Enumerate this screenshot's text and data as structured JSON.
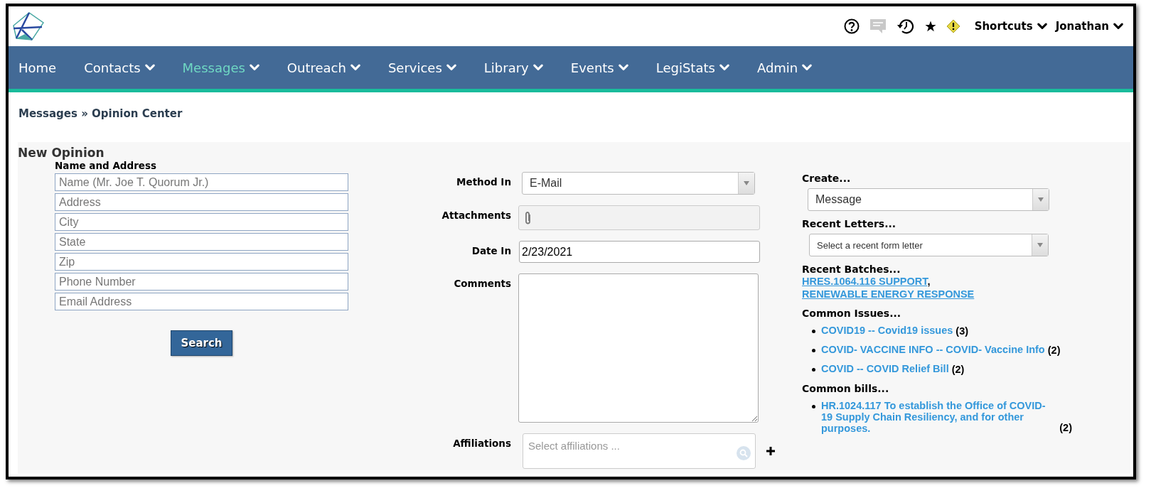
{
  "header": {
    "shortcuts": "Shortcuts",
    "user": "Jonathan"
  },
  "nav": [
    {
      "label": "Home",
      "has_menu": false,
      "selected": false
    },
    {
      "label": "Contacts",
      "has_menu": true,
      "selected": false
    },
    {
      "label": "Messages",
      "has_menu": true,
      "selected": true
    },
    {
      "label": "Outreach",
      "has_menu": true,
      "selected": false
    },
    {
      "label": "Services",
      "has_menu": true,
      "selected": false
    },
    {
      "label": "Library",
      "has_menu": true,
      "selected": false
    },
    {
      "label": "Events",
      "has_menu": true,
      "selected": false
    },
    {
      "label": "LegiStats",
      "has_menu": true,
      "selected": false
    },
    {
      "label": "Admin",
      "has_menu": true,
      "selected": false
    }
  ],
  "breadcrumb": "Messages » Opinion Center",
  "form": {
    "title": "New Opinion",
    "name_address": {
      "label": "Name and Address",
      "fields": [
        {
          "placeholder": "Name (Mr. Joe T. Quorum Jr.)"
        },
        {
          "placeholder": "Address"
        },
        {
          "placeholder": "City"
        },
        {
          "placeholder": "State"
        },
        {
          "placeholder": "Zip"
        },
        {
          "placeholder": "Phone Number"
        },
        {
          "placeholder": "Email Address"
        }
      ]
    },
    "search_button": "Search"
  },
  "details": {
    "method_in": {
      "label": "Method In",
      "value": "E-Mail"
    },
    "attachments": {
      "label": "Attachments"
    },
    "date_in": {
      "label": "Date In",
      "value": "2/23/2021"
    },
    "comments": {
      "label": "Comments"
    },
    "affiliations": {
      "label": "Affiliations",
      "placeholder": "Select affiliations ..."
    }
  },
  "sidebar": {
    "create": {
      "label": "Create...",
      "value": "Message"
    },
    "recent_letters": {
      "label": "Recent Letters...",
      "placeholder": "Select a recent form letter"
    },
    "recent_batches": {
      "label": "Recent Batches...",
      "separator": ",",
      "links": [
        "HRES.1064.116 SUPPORT",
        "RENEWABLE ENERGY RESPONSE"
      ]
    },
    "common_issues": {
      "label": "Common Issues...",
      "items": [
        {
          "link": "COVID19 -- Covid19 issues",
          "count": "(3)"
        },
        {
          "link": "COVID- VACCINE INFO -- COVID- Vaccine Info",
          "count": "(2)"
        },
        {
          "link": "COVID -- COVID Relief Bill",
          "count": "(2)"
        }
      ]
    },
    "common_bills": {
      "label": "Common bills...",
      "items": [
        {
          "link": "HR.1024.117 To establish the Office of COVID-19 Supply Chain Resiliency, and for other purposes.",
          "count": "(2)"
        }
      ]
    }
  }
}
